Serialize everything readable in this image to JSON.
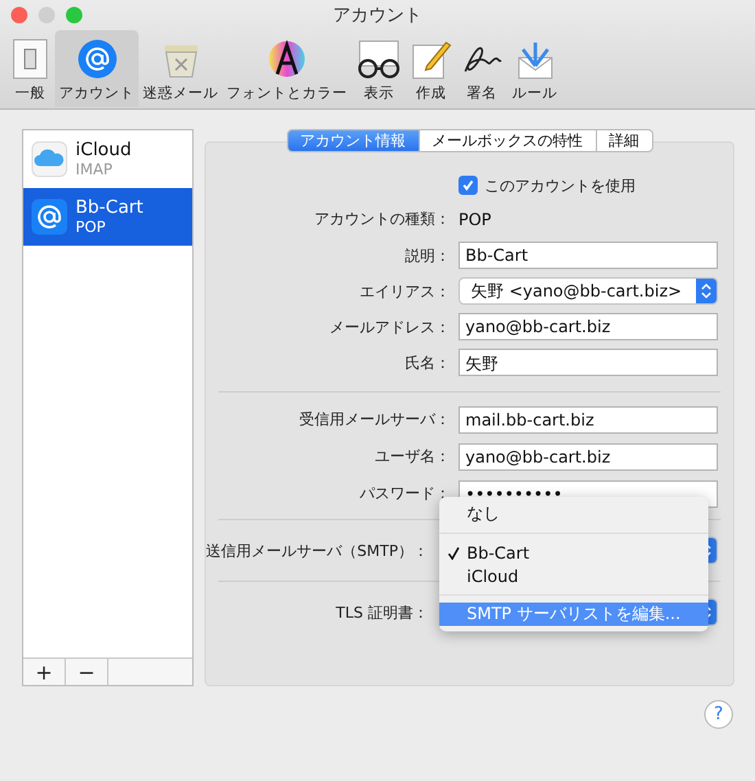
{
  "window": {
    "title": "アカウント"
  },
  "toolbar": [
    {
      "label": "一般",
      "kind": "general",
      "selected": false
    },
    {
      "label": "アカウント",
      "kind": "accounts",
      "selected": true
    },
    {
      "label": "迷惑メール",
      "kind": "junk",
      "selected": false
    },
    {
      "label": "フォントとカラー",
      "kind": "fonts",
      "selected": false
    },
    {
      "label": "表示",
      "kind": "viewing",
      "selected": false
    },
    {
      "label": "作成",
      "kind": "composing",
      "selected": false
    },
    {
      "label": "署名",
      "kind": "signatures",
      "selected": false
    },
    {
      "label": "ルール",
      "kind": "rules",
      "selected": false
    }
  ],
  "accounts": [
    {
      "name": "iCloud",
      "type": "IMAP",
      "kind": "cloud",
      "selected": false
    },
    {
      "name": "Bb-Cart",
      "type": "POP",
      "kind": "at",
      "selected": true
    }
  ],
  "list_buttons": [
    "+",
    "−"
  ],
  "tabs": [
    {
      "label": "アカウント情報",
      "selected": true
    },
    {
      "label": "メールボックスの特性",
      "selected": false
    },
    {
      "label": "詳細",
      "selected": false
    }
  ],
  "enable_checkbox": {
    "label": "このアカウントを使用",
    "checked": true
  },
  "account_type": {
    "label": "アカウントの種類：",
    "value": "POP"
  },
  "fields": [
    {
      "label": "説明：",
      "kind": "text",
      "value": "Bb-Cart"
    },
    {
      "label": "エイリアス：",
      "kind": "select",
      "value": "矢野 <yano@bb-cart.biz>"
    },
    {
      "label": "メールアドレス：",
      "kind": "text",
      "value": "yano@bb-cart.biz"
    },
    {
      "label": "氏名：",
      "kind": "text",
      "value": "矢野"
    }
  ],
  "server_fields": [
    {
      "label": "受信用メールサーバ：",
      "value": "mail.bb-cart.biz"
    },
    {
      "label": "ユーザ名：",
      "value": "yano@bb-cart.biz"
    },
    {
      "label": "パスワード：",
      "value": "••••••••••"
    }
  ],
  "smtp": {
    "label": "送信用メールサーバ（SMTP）："
  },
  "tls": {
    "label": "TLS 証明書："
  },
  "menu": {
    "groups": [
      [
        {
          "label": "なし",
          "checked": false,
          "highlighted": false
        }
      ],
      [
        {
          "label": "Bb-Cart",
          "checked": true,
          "highlighted": false
        },
        {
          "label": "iCloud",
          "checked": false,
          "highlighted": false
        }
      ],
      [
        {
          "label": "SMTP サーバリストを編集...",
          "checked": false,
          "highlighted": true
        }
      ]
    ]
  },
  "help_button": "?"
}
